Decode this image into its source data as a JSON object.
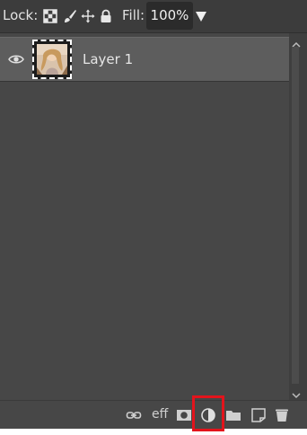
{
  "lockbar": {
    "lock_label": "Lock:",
    "fill_label": "Fill:",
    "fill_value": "100%",
    "icons": [
      "lock-transparent-pixels-icon",
      "lock-image-pixels-icon",
      "lock-position-icon",
      "lock-all-icon"
    ]
  },
  "layers": [
    {
      "name": "Layer 1",
      "visible": true,
      "selected": true
    }
  ],
  "toolbar": {
    "fx_label": "eff",
    "icons": [
      "link-layers-icon",
      "layer-effects-icon",
      "add-mask-icon",
      "adjustment-layer-icon",
      "new-group-icon",
      "new-layer-icon",
      "delete-layer-icon"
    ],
    "highlighted": "adjustment-layer-icon",
    "highlight_color": "#e3141c"
  }
}
